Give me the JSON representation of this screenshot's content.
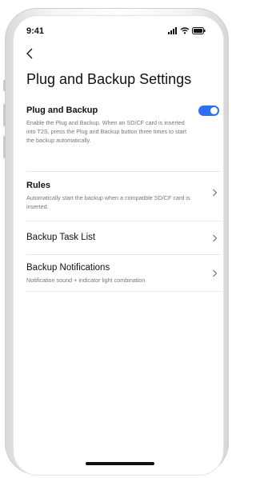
{
  "status_bar": {
    "time": "9:41"
  },
  "page": {
    "title": "Plug and Backup Settings"
  },
  "settings": {
    "plug_and_backup": {
      "label": "Plug and Backup",
      "description": "Enable the Plug and Backup. When an SD/CF card is inserted into T2S, press the Plug and Backup button three times to start the backup automatically.",
      "enabled": true
    },
    "rules": {
      "label": "Rules",
      "description": "Automatically start the backup when a compatible SD/CF card is inserted."
    },
    "backup_task_list": {
      "label": "Backup Task List"
    },
    "backup_notifications": {
      "label": "Backup Notifications",
      "description": "Notification sound + indicator light combination"
    }
  },
  "colors": {
    "accent": "#2f6ff2",
    "text_primary": "#111111",
    "text_secondary": "#777777",
    "divider": "#e7e7e7"
  }
}
